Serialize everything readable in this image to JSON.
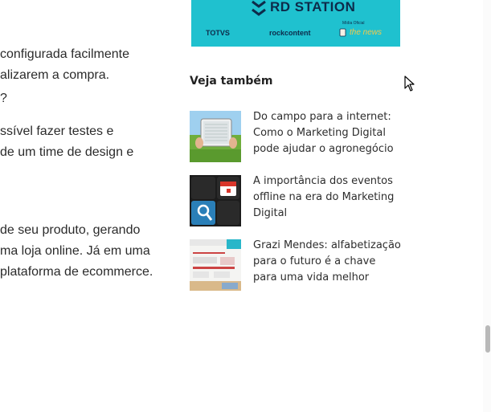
{
  "article": {
    "lines": [
      "configurada facilmente",
      "alizarem a compra.",
      "?",
      "ssível fazer testes e",
      "de um time de design e",
      "de seu produto, gerando",
      "ma loja online. Já em uma",
      "plataforma de ecommerce."
    ]
  },
  "banner": {
    "brand": "RD STATION",
    "official_label": "Mídia Oficial",
    "partners": [
      "TOTVS",
      "rockcontent",
      "the news"
    ]
  },
  "sidebar": {
    "title": "Veja também",
    "posts": [
      {
        "title": "Do campo para a internet: Como o Marketing Digital pode ajudar o agronegócio",
        "image": "tablet-in-field-image"
      },
      {
        "title": "A importância dos eventos offline na era do Marketing Digital",
        "image": "keyboard-calendar-image"
      },
      {
        "title": "Grazi Mendes: alfabetização para o futuro é a chave para uma vida melhor",
        "image": "newspaper-collage-image"
      }
    ]
  },
  "colors": {
    "banner_bg": "#1fc1cf",
    "text": "#2b2b2b",
    "scroll_thumb": "#b9b9b9"
  }
}
